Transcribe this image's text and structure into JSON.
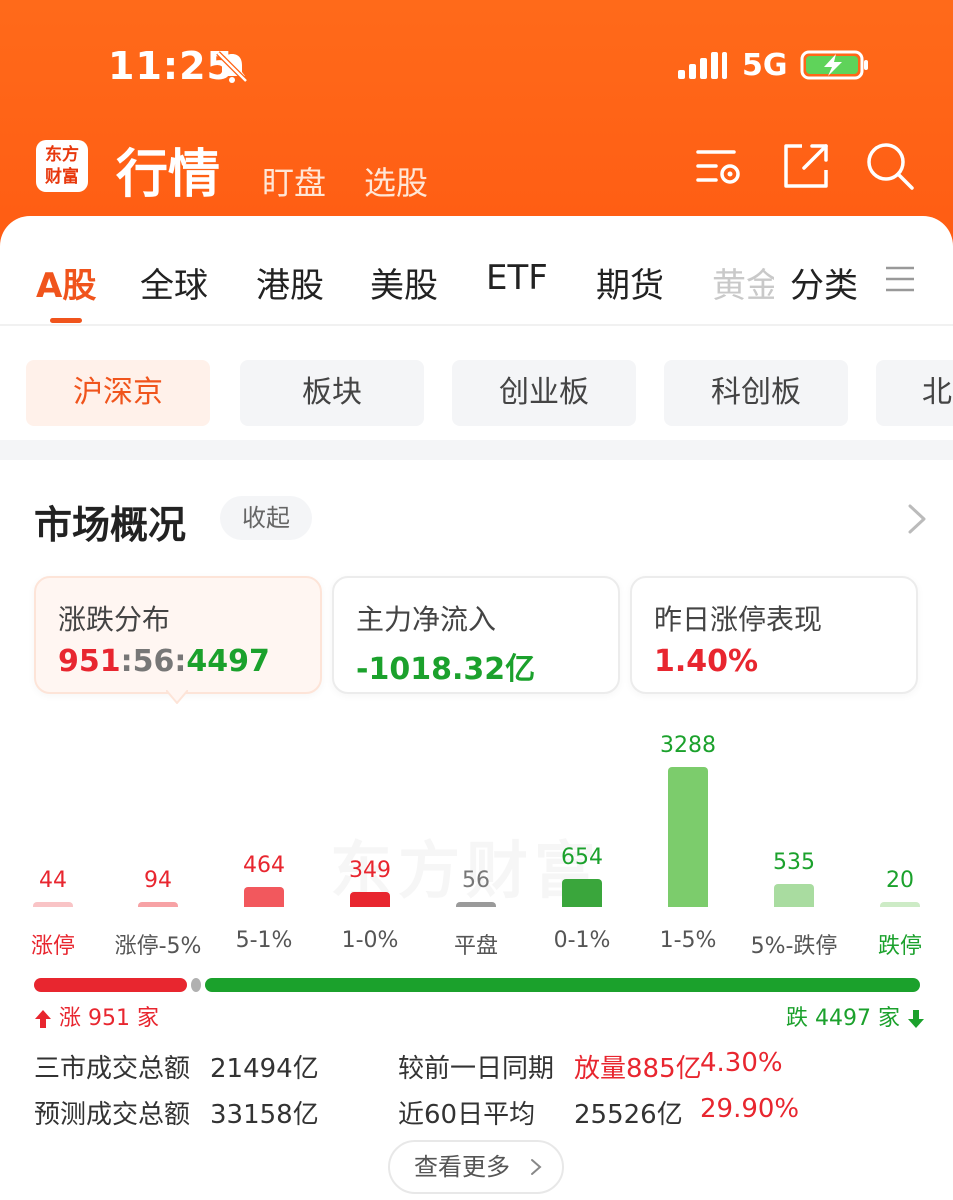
{
  "status_bar": {
    "time": "11:25",
    "network": "5G",
    "icons": [
      "bell-muted-icon",
      "signal-icon",
      "battery-charging-icon"
    ]
  },
  "header": {
    "logo_text_line1": "东方",
    "logo_text_line2": "财富",
    "title": "行情",
    "tabs": [
      {
        "label": "盯盘"
      },
      {
        "label": "选股"
      }
    ],
    "icons": [
      "settings-list-icon",
      "share-icon",
      "search-icon"
    ]
  },
  "market_tabs": [
    {
      "label": "A股",
      "active": true
    },
    {
      "label": "全球"
    },
    {
      "label": "港股"
    },
    {
      "label": "美股"
    },
    {
      "label": "ETF"
    },
    {
      "label": "期货"
    },
    {
      "label": "黄金"
    },
    {
      "label": "分类"
    }
  ],
  "sub_tabs": [
    {
      "label": "沪深京",
      "active": true
    },
    {
      "label": "板块"
    },
    {
      "label": "创业板"
    },
    {
      "label": "科创板"
    },
    {
      "label": "北"
    }
  ],
  "overview": {
    "title": "市场概况",
    "collapse_label": "收起",
    "cards": [
      {
        "label": "涨跌分布",
        "value_up": "951",
        "sep1": ":",
        "value_flat": "56",
        "sep2": ":",
        "value_down": "4497"
      },
      {
        "label": "主力净流入",
        "value": "-1018.32亿"
      },
      {
        "label": "昨日涨停表现",
        "value": "1.40%"
      }
    ]
  },
  "colors": {
    "accent": "#f0541c",
    "up": "#e8262f",
    "down": "#1ba12c",
    "flat": "#999999"
  },
  "chart_data": {
    "type": "bar",
    "categories": [
      "涨停",
      "涨停-5%",
      "5-1%",
      "1-0%",
      "平盘",
      "0-1%",
      "1-5%",
      "5%-跌停",
      "跌停"
    ],
    "values": [
      44,
      94,
      464,
      349,
      56,
      654,
      3288,
      535,
      20
    ],
    "labels": [
      "44",
      "94",
      "464",
      "349",
      "56",
      "654",
      "3288",
      "535",
      "20"
    ],
    "bar_colors": [
      "#f9c4c6",
      "#f7a2a5",
      "#f2585d",
      "#e8262f",
      "#9a9a9a",
      "#3aa63c",
      "#7ccc6c",
      "#a9dca0",
      "#cdebc6"
    ],
    "label_colors": [
      "#e8262f",
      "#e8262f",
      "#e8262f",
      "#e8262f",
      "#777777",
      "#1ba12c",
      "#1ba12c",
      "#1ba12c",
      "#1ba12c"
    ],
    "category_colors": [
      "#e8262f",
      "#555555",
      "#555555",
      "#555555",
      "#555555",
      "#555555",
      "#555555",
      "#555555",
      "#1ba12c"
    ]
  },
  "ratio": {
    "up_count": 951,
    "flat_count": 56,
    "down_count": 4497,
    "up_label": "涨 951 家",
    "down_label": "跌 4497 家"
  },
  "summary": {
    "row1": {
      "label": "三市成交总额",
      "value": "21494亿",
      "cmp_label": "较前一日同期",
      "cmp_value1": "放量885亿",
      "cmp_value2": "4.30%"
    },
    "row2": {
      "label": "预测成交总额",
      "value": "33158亿",
      "cmp_label": "近60日平均",
      "cmp_value1": "25526亿",
      "cmp_value2": "29.90%"
    }
  },
  "more_button": {
    "label": "查看更多"
  }
}
